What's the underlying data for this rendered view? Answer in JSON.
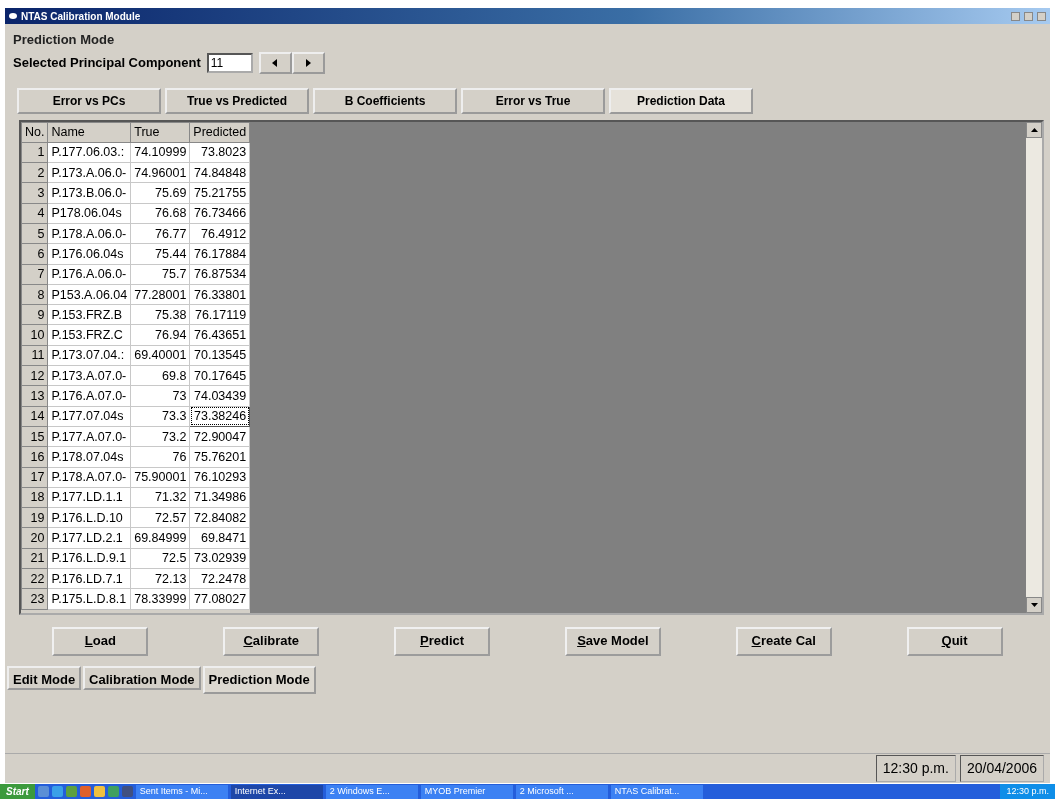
{
  "window": {
    "title": "NTAS Calibration Module"
  },
  "frame": {
    "title": "Prediction Mode",
    "pc_label": "Selected Principal Component",
    "pc_value": "11"
  },
  "tabs": [
    {
      "label": "Error vs PCs",
      "selected": false
    },
    {
      "label": "True vs Predicted",
      "selected": false
    },
    {
      "label": "B Coefficients",
      "selected": false
    },
    {
      "label": "Error vs True",
      "selected": false
    },
    {
      "label": "Prediction Data",
      "selected": true
    }
  ],
  "table": {
    "columns": [
      "No.",
      "Name",
      "True",
      "Predicted"
    ],
    "rows": [
      {
        "no": "1",
        "name": "P.177.06.03.:",
        "true": "74.10999",
        "predicted": "73.8023",
        "focused": false
      },
      {
        "no": "2",
        "name": "P.173.A.06.0-",
        "true": "74.96001",
        "predicted": "74.84848",
        "focused": false
      },
      {
        "no": "3",
        "name": "P.173.B.06.0-",
        "true": "75.69",
        "predicted": "75.21755",
        "focused": false
      },
      {
        "no": "4",
        "name": "P178.06.04s",
        "true": "76.68",
        "predicted": "76.73466",
        "focused": false
      },
      {
        "no": "5",
        "name": "P.178.A.06.0-",
        "true": "76.77",
        "predicted": "76.4912",
        "focused": false
      },
      {
        "no": "6",
        "name": "P.176.06.04s",
        "true": "75.44",
        "predicted": "76.17884",
        "focused": false
      },
      {
        "no": "7",
        "name": "P.176.A.06.0-",
        "true": "75.7",
        "predicted": "76.87534",
        "focused": false
      },
      {
        "no": "8",
        "name": "P153.A.06.04",
        "true": "77.28001",
        "predicted": "76.33801",
        "focused": false
      },
      {
        "no": "9",
        "name": "P.153.FRZ.B",
        "true": "75.38",
        "predicted": "76.17119",
        "focused": false
      },
      {
        "no": "10",
        "name": "P.153.FRZ.C",
        "true": "76.94",
        "predicted": "76.43651",
        "focused": false
      },
      {
        "no": "11",
        "name": "P.173.07.04.:",
        "true": "69.40001",
        "predicted": "70.13545",
        "focused": false
      },
      {
        "no": "12",
        "name": "P.173.A.07.0-",
        "true": "69.8",
        "predicted": "70.17645",
        "focused": false
      },
      {
        "no": "13",
        "name": "P.176.A.07.0-",
        "true": "73",
        "predicted": "74.03439",
        "focused": false
      },
      {
        "no": "14",
        "name": "P.177.07.04s",
        "true": "73.3",
        "predicted": "73.38246",
        "focused": true
      },
      {
        "no": "15",
        "name": "P.177.A.07.0-",
        "true": "73.2",
        "predicted": "72.90047",
        "focused": false
      },
      {
        "no": "16",
        "name": "P.178.07.04s",
        "true": "76",
        "predicted": "75.76201",
        "focused": false
      },
      {
        "no": "17",
        "name": "P.178.A.07.0-",
        "true": "75.90001",
        "predicted": "76.10293",
        "focused": false
      },
      {
        "no": "18",
        "name": "P.177.LD.1.1",
        "true": "71.32",
        "predicted": "71.34986",
        "focused": false
      },
      {
        "no": "19",
        "name": "P.176.L.D.10",
        "true": "72.57",
        "predicted": "72.84082",
        "focused": false
      },
      {
        "no": "20",
        "name": "P.177.LD.2.1",
        "true": "69.84999",
        "predicted": "69.8471",
        "focused": false
      },
      {
        "no": "21",
        "name": "P.176.L.D.9.1",
        "true": "72.5",
        "predicted": "73.02939",
        "focused": false
      },
      {
        "no": "22",
        "name": "P.176.LD.7.1",
        "true": "72.13",
        "predicted": "72.2478",
        "focused": false
      },
      {
        "no": "23",
        "name": "P.175.L.D.8.1",
        "true": "78.33999",
        "predicted": "77.08027",
        "focused": false
      }
    ]
  },
  "buttons": [
    {
      "label": "Load",
      "first_letter_underlined": true
    },
    {
      "label": "Calibrate",
      "first_letter_underlined": true
    },
    {
      "label": "Predict",
      "first_letter_underlined": true
    },
    {
      "label": "Save Model",
      "first_letter_underlined": true
    },
    {
      "label": "Create Cal",
      "first_letter_underlined": true
    },
    {
      "label": "Quit",
      "first_letter_underlined": true
    }
  ],
  "mode_tabs": [
    {
      "label": "Edit Mode",
      "selected": false
    },
    {
      "label": "Calibration Mode",
      "selected": false
    },
    {
      "label": "Prediction Mode",
      "selected": true
    }
  ],
  "status_bar": {
    "time": "12:30 p.m.",
    "date": "20/04/2006"
  },
  "taskbar": {
    "start": "Start",
    "items": [
      {
        "label": "Sent Items - Mi...",
        "active": false
      },
      {
        "label": "Internet Ex...",
        "active": true
      },
      {
        "label": "2 Windows E...",
        "active": false
      },
      {
        "label": "MYOB Premier",
        "active": false
      },
      {
        "label": "2 Microsoft ...",
        "active": false
      },
      {
        "label": "NTAS Calibrat...",
        "active": false
      }
    ],
    "clock": "12:30 p.m."
  }
}
